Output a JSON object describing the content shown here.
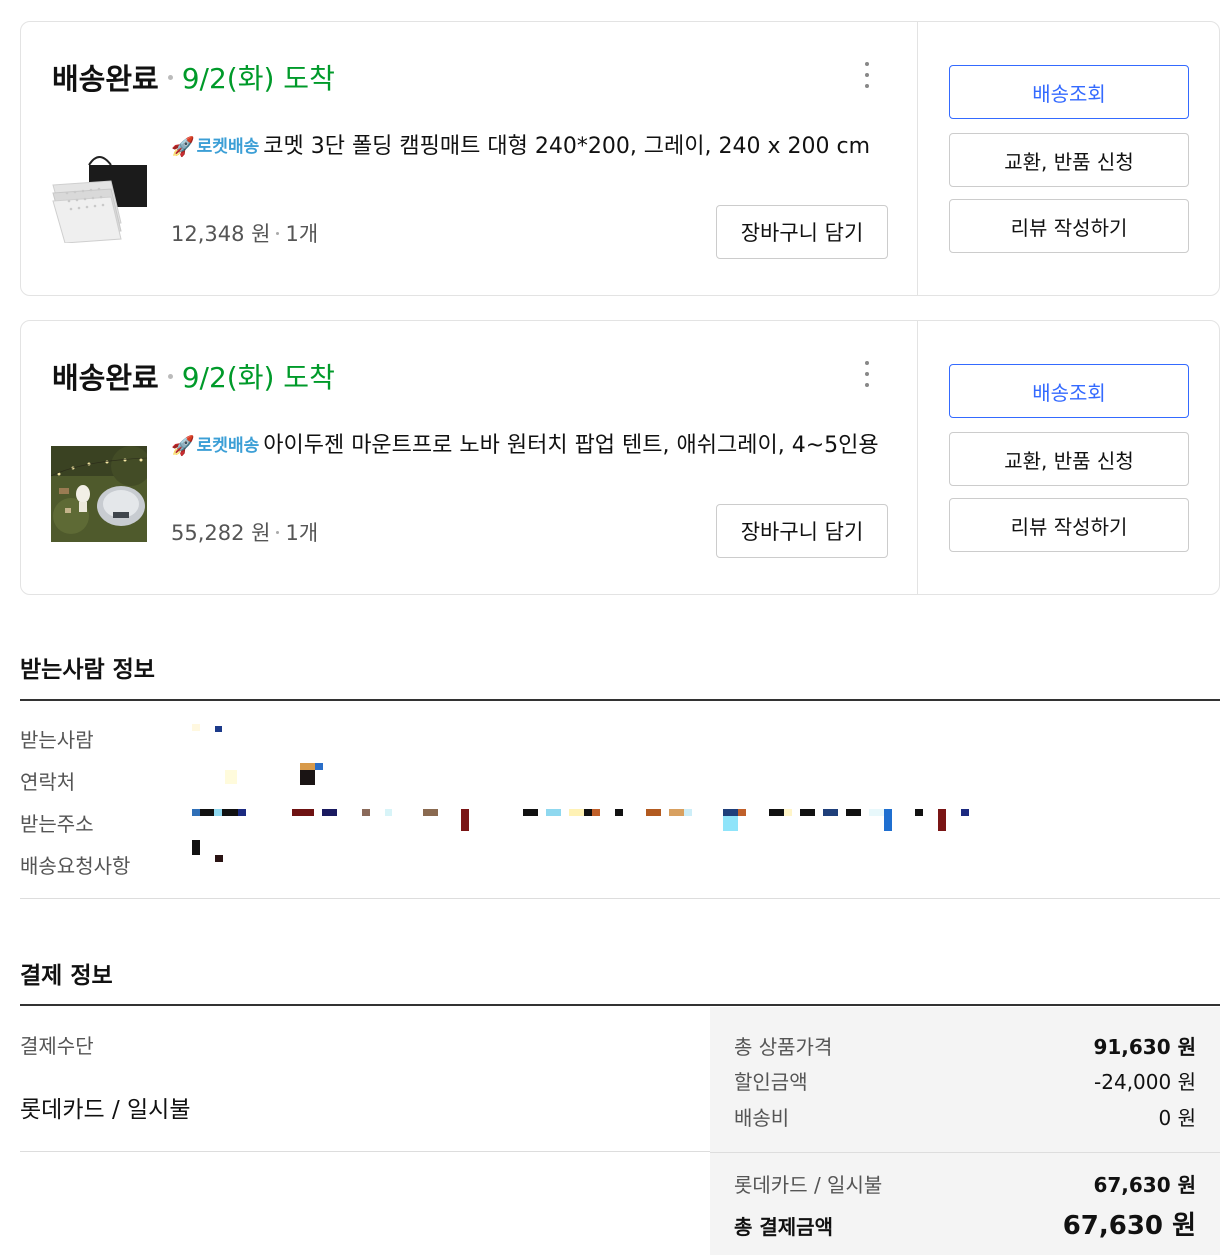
{
  "orders": [
    {
      "status": "배송완료",
      "arrival": "9/2(화) 도착",
      "rocket_label": "로켓배송",
      "product_name": "코멧 3단 폴딩 캠핑매트 대형 240*200, 그레이, 240 x 200 cm",
      "price": "12,348 원",
      "quantity": "1개",
      "cart_button": "장바구니 담기",
      "track_button": "배송조회",
      "exchange_button": "교환, 반품 신청",
      "review_button": "리뷰 작성하기"
    },
    {
      "status": "배송완료",
      "arrival": "9/2(화) 도착",
      "rocket_label": "로켓배송",
      "product_name": "아이두젠 마운트프로 노바 원터치 팝업 텐트, 애쉬그레이, 4~5인용",
      "price": "55,282 원",
      "quantity": "1개",
      "cart_button": "장바구니 담기",
      "track_button": "배송조회",
      "exchange_button": "교환, 반품 신청",
      "review_button": "리뷰 작성하기"
    }
  ],
  "recipient": {
    "title": "받는사람 정보",
    "labels": {
      "name": "받는사람",
      "phone": "연락처",
      "address": "받는주소",
      "request": "배송요청사항"
    }
  },
  "payment": {
    "title": "결제 정보",
    "method_label": "결제수단",
    "method_value": "롯데카드 / 일시불",
    "total_product_label": "총 상품가격",
    "total_product_value": "91,630 원",
    "discount_label": "할인금액",
    "discount_value": "-24,000 원",
    "shipping_label": "배송비",
    "shipping_value": "0 원",
    "card_label": "롯데카드 / 일시불",
    "card_value": "67,630 원",
    "grand_total_label": "총 결제금액",
    "grand_total_value": "67,630 원"
  },
  "colors": {
    "arrival_green": "#009a2a",
    "primary_blue": "#346aff",
    "rocket_blue": "#3c9fd6"
  }
}
